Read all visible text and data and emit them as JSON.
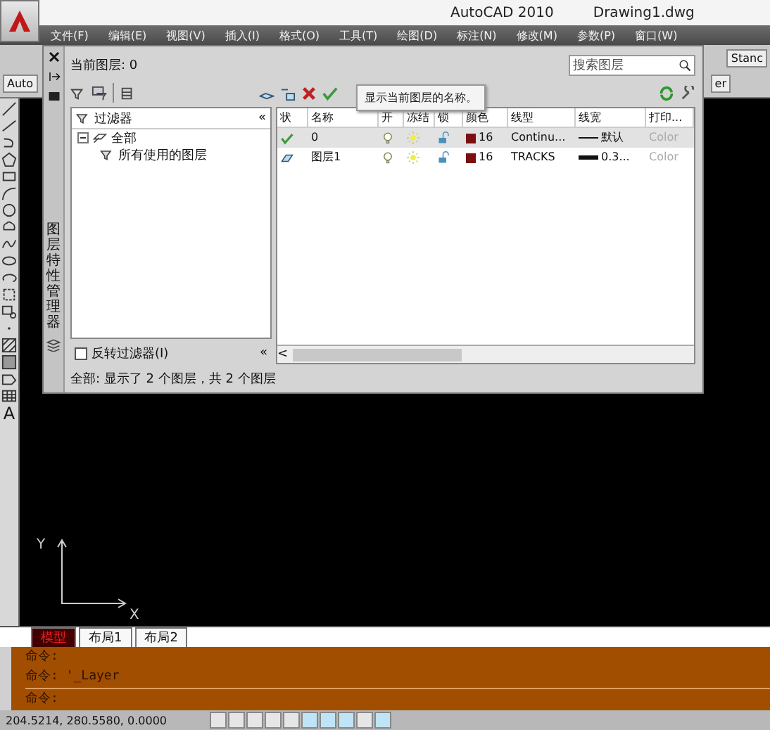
{
  "app": {
    "title": "AutoCAD 2010",
    "document": "Drawing1.dwg"
  },
  "menu": [
    "文件(F)",
    "编辑(E)",
    "视图(V)",
    "插入(I)",
    "格式(O)",
    "工具(T)",
    "绘图(D)",
    "标注(N)",
    "修改(M)",
    "参数(P)",
    "窗口(W)"
  ],
  "toolbar_fragments": {
    "left": "Auto",
    "right_top": "Stanc",
    "right_bottom": "er"
  },
  "text_tool_glyph": "A",
  "ucs": {
    "x": "X",
    "y": "Y"
  },
  "layer_palette": {
    "title": "图层特性管理器",
    "current_layer": "当前图层: 0",
    "search": {
      "placeholder": "搜索图层"
    },
    "tooltip": "显示当前图层的名称。",
    "filters": {
      "header": "过滤器",
      "collapse": "«",
      "tree": [
        {
          "label": "全部",
          "expanded": true,
          "children": [
            {
              "label": "所有使用的图层"
            }
          ]
        }
      ],
      "invert": {
        "label": "反转过滤器(I)",
        "checked": false
      }
    },
    "columns": [
      "状",
      "名称",
      "开",
      "冻结",
      "锁",
      "颜色",
      "线型",
      "线宽",
      "打印..."
    ],
    "rows": [
      {
        "kind": "current",
        "name": "0",
        "selected": true,
        "on": true,
        "frozen": false,
        "locked": false,
        "color": "#7a1010",
        "color_index": "16",
        "linetype": "Continu...",
        "lineweight": {
          "kind": "thin",
          "text": "默认"
        },
        "plot": "Color"
      },
      {
        "kind": "layer",
        "name": "图层1",
        "selected": false,
        "on": true,
        "frozen": false,
        "locked": false,
        "color": "#7a1010",
        "color_index": "16",
        "linetype": "TRACKS",
        "lineweight": {
          "kind": "thick",
          "text": "0.3..."
        },
        "plot": "Color"
      }
    ],
    "scroll_left": "<",
    "footer": "全部: 显示了 2 个图层，共 2 个图层"
  },
  "layout_tabs": [
    {
      "label": "模型",
      "selected": true
    },
    {
      "label": "布局1",
      "selected": false
    },
    {
      "label": "布局2",
      "selected": false
    }
  ],
  "command_history": [
    "命令:",
    "命令: '_Layer"
  ],
  "command_prompt": "命令:",
  "status_bar": {
    "coordinates": "204.5214, 280.5580, 0.0000",
    "toggles": [
      {
        "on": false
      },
      {
        "on": false
      },
      {
        "on": false
      },
      {
        "on": false
      },
      {
        "on": false
      },
      {
        "on": true
      },
      {
        "on": true
      },
      {
        "on": true
      },
      {
        "on": false
      },
      {
        "on": true
      }
    ]
  }
}
